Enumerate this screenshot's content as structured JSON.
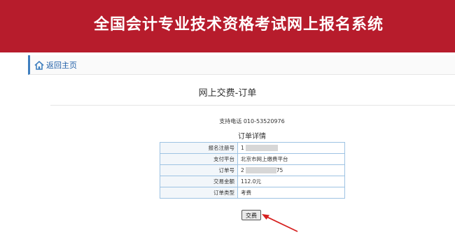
{
  "header": {
    "title": "全国会计专业技术资格考试网上报名系统"
  },
  "nav": {
    "home_label": "返回主页"
  },
  "page": {
    "heading": "网上交费-订单"
  },
  "support": {
    "text": "支持电话 010-53520976"
  },
  "order_details": {
    "title": "订单详情",
    "rows": [
      {
        "label": "报名注册号",
        "value": "1"
      },
      {
        "label": "支付平台",
        "value": "北京市网上缴费平台"
      },
      {
        "label": "订单号",
        "value": "2",
        "suffix": "75"
      },
      {
        "label": "交易金额",
        "value": "112.0元"
      },
      {
        "label": "订单类型",
        "value": "考费"
      }
    ]
  },
  "actions": {
    "pay_label": "交费"
  },
  "colors": {
    "banner": "#b71c2c",
    "link": "#1f5fa8",
    "annotation_arrow": "#d6201f"
  }
}
